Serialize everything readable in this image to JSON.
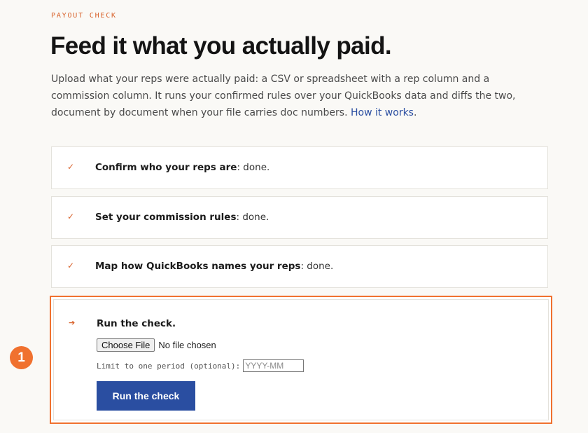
{
  "header": {
    "eyebrow": "PAYOUT CHECK",
    "title": "Feed it what you actually paid.",
    "lede": "Upload what your reps were actually paid: a CSV or spreadsheet with a rep column and a commission column. It runs your confirmed rules over your QuickBooks data and diffs the two, document by document when your file carries doc numbers.",
    "link": "How it works",
    "after_link": "."
  },
  "steps": [
    {
      "mark": "✓",
      "label": "Confirm who your reps are",
      "status": ": done."
    },
    {
      "mark": "✓",
      "label": "Set your commission rules",
      "status": ": done."
    },
    {
      "mark": "✓",
      "label": "Map how QuickBooks names your reps",
      "status": ": done."
    }
  ],
  "run": {
    "mark": "➔",
    "title": "Run the check.",
    "file_button": "Choose File",
    "file_status": "No file chosen",
    "period_label": "Limit to one period (optional):",
    "period_placeholder": "YYYY-MM",
    "period_value": "",
    "submit": "Run the check"
  },
  "badge": {
    "number": "1"
  },
  "colors": {
    "accent": "#d8622b",
    "highlight": "#f0712f",
    "primary_button": "#2a4ea1",
    "link": "#2a4ea1",
    "background": "#faf9f6"
  }
}
